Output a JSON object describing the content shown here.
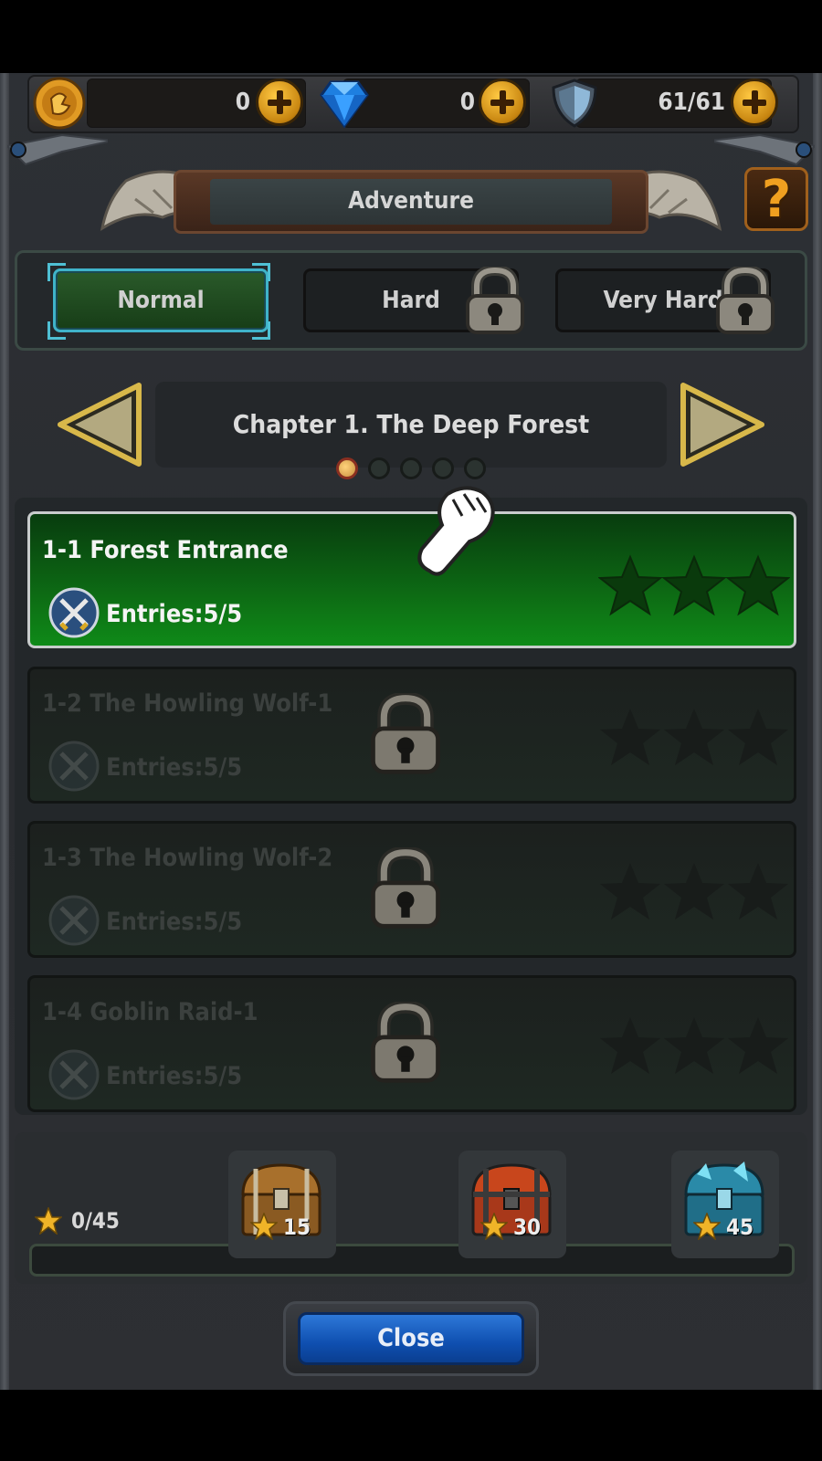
{
  "resources": {
    "gold": {
      "icon": "gold-coin-icon",
      "value": "0"
    },
    "gems": {
      "icon": "diamond-icon",
      "value": "0"
    },
    "stamina": {
      "icon": "shield-icon",
      "value": "61/61"
    }
  },
  "header": {
    "title": "Adventure",
    "help_label": "?"
  },
  "difficulty_tabs": [
    {
      "label": "Normal",
      "active": true,
      "locked": false
    },
    {
      "label": "Hard",
      "active": false,
      "locked": true
    },
    {
      "label": "Very Hard",
      "active": false,
      "locked": true
    }
  ],
  "chapter": {
    "title": "Chapter 1. The Deep Forest",
    "page_count": 5,
    "current_page": 1
  },
  "stages": [
    {
      "name": "1-1 Forest Entrance",
      "entries": "Entries:5/5",
      "locked": false,
      "stars": 0
    },
    {
      "name": "1-2 The Howling Wolf-1",
      "entries": "Entries:5/5",
      "locked": true,
      "stars": 0
    },
    {
      "name": "1-3 The Howling Wolf-2",
      "entries": "Entries:5/5",
      "locked": true,
      "stars": 0
    },
    {
      "name": "1-4 Goblin Raid-1",
      "entries": "Entries:5/5",
      "locked": true,
      "stars": 0
    }
  ],
  "rewards": {
    "star_progress": "0/45",
    "progress_fraction": 0,
    "chests": [
      {
        "icon": "wooden-chest-icon",
        "required": "15"
      },
      {
        "icon": "red-chest-icon",
        "required": "30"
      },
      {
        "icon": "crystal-chest-icon",
        "required": "45"
      }
    ]
  },
  "close_label": "Close",
  "colors": {
    "accent_green": "#0d6a14",
    "tab_border": "#3fb3c9",
    "close_blue": "#1a62c4",
    "gold": "#f0a020"
  }
}
